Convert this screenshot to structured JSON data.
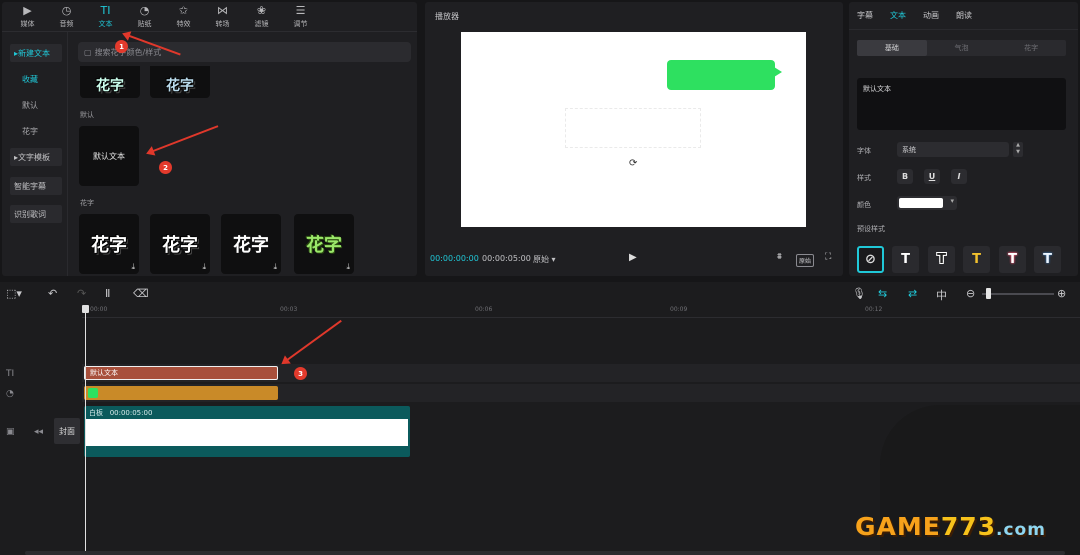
{
  "toolbar": {
    "items": [
      {
        "label": "媒体",
        "icon": "media-icon"
      },
      {
        "label": "音频",
        "icon": "audio-icon"
      },
      {
        "label": "文本",
        "icon": "text-icon",
        "active": true
      },
      {
        "label": "贴纸",
        "icon": "sticker-icon"
      },
      {
        "label": "特效",
        "icon": "effects-icon"
      },
      {
        "label": "转场",
        "icon": "transition-icon"
      },
      {
        "label": "滤镜",
        "icon": "filter-icon"
      },
      {
        "label": "调节",
        "icon": "adjust-icon"
      }
    ]
  },
  "sidebar": {
    "items": [
      "新建文本",
      "收藏",
      "默认",
      "花字",
      "文字模板",
      "智能字幕",
      "识别歌词"
    ]
  },
  "search": {
    "placeholder": "搜索花字颜色/样式"
  },
  "library": {
    "default_label": "默认",
    "default_card": "默认文本",
    "huazi_label": "花字",
    "huazi_cards": [
      "花字",
      "花字",
      "花字",
      "花字"
    ],
    "top_cards": [
      "花字",
      "花字"
    ]
  },
  "player": {
    "title": "播放器",
    "time_current": "00:00:00:00",
    "time_total": "00:00:05:00",
    "ratio": "原始",
    "play": "▶",
    "original_label": "原始"
  },
  "props": {
    "tabs": [
      "字幕",
      "文本",
      "动画",
      "朗读"
    ],
    "active_tab": "文本",
    "subtabs": [
      "基础",
      "气泡",
      "花字"
    ],
    "text_value": "默认文本",
    "font_label": "字体",
    "font_value": "系统",
    "style_label": "样式",
    "style_buttons": [
      "B",
      "U",
      "I"
    ],
    "color_label": "颜色",
    "preset_label": "预设样式",
    "accent": "#20c8d8"
  },
  "timeline": {
    "ruler_ticks": [
      "00:00",
      "00:03",
      "00:06",
      "00:09",
      "00:12"
    ],
    "text_clip": "默认文本",
    "main_clip_name": "白板",
    "main_clip_duration": "00:00:05:00",
    "cover_label": "封面"
  },
  "annotations": [
    "1",
    "2",
    "3"
  ],
  "watermark": {
    "text": "GAME773.com"
  }
}
